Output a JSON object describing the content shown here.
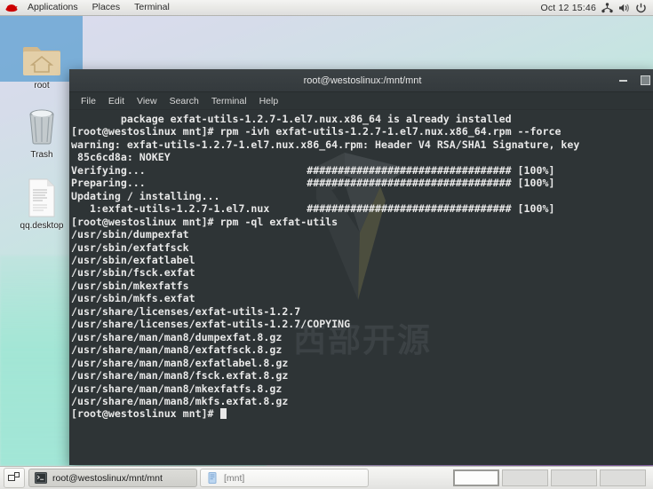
{
  "top_panel": {
    "logo_icon": "redhat-logo-icon",
    "menus": [
      {
        "label": "Applications",
        "name": "menu-applications"
      },
      {
        "label": "Places",
        "name": "menu-places"
      },
      {
        "label": "Terminal",
        "name": "menu-terminal"
      }
    ],
    "clock": "Oct 12  15:46",
    "tray": [
      {
        "icon": "network-icon"
      },
      {
        "icon": "volume-icon"
      },
      {
        "icon": "power-icon"
      }
    ]
  },
  "desktop": {
    "icons": [
      {
        "label": "root",
        "icon": "home-folder-icon",
        "selected": true
      },
      {
        "label": "Trash",
        "icon": "trash-icon",
        "selected": false
      },
      {
        "label": "qq.desktop",
        "icon": "text-file-icon",
        "selected": false
      }
    ]
  },
  "terminal": {
    "title": "root@westoslinux:/mnt/mnt",
    "menus": [
      "File",
      "Edit",
      "View",
      "Search",
      "Terminal",
      "Help"
    ],
    "controls": {
      "minimize": "minimize-icon",
      "maximize": "maximize-icon"
    },
    "watermark_text": "西部开源",
    "content": "        package exfat-utils-1.2.7-1.el7.nux.x86_64 is already installed\n[root@westoslinux mnt]# rpm -ivh exfat-utils-1.2.7-1.el7.nux.x86_64.rpm --force\nwarning: exfat-utils-1.2.7-1.el7.nux.x86_64.rpm: Header V4 RSA/SHA1 Signature, key\n 85c6cd8a: NOKEY\nVerifying...                          ################################# [100%]\nPreparing...                          ################################# [100%]\nUpdating / installing...\n   1:exfat-utils-1.2.7-1.el7.nux      ################################# [100%]\n[root@westoslinux mnt]# rpm -ql exfat-utils\n/usr/sbin/dumpexfat\n/usr/sbin/exfatfsck\n/usr/sbin/exfatlabel\n/usr/sbin/fsck.exfat\n/usr/sbin/mkexfatfs\n/usr/sbin/mkfs.exfat\n/usr/share/licenses/exfat-utils-1.2.7\n/usr/share/licenses/exfat-utils-1.2.7/COPYING\n/usr/share/man/man8/dumpexfat.8.gz\n/usr/share/man/man8/exfatfsck.8.gz\n/usr/share/man/man8/exfatlabel.8.gz\n/usr/share/man/man8/fsck.exfat.8.gz\n/usr/share/man/man8/mkexfatfs.8.gz\n/usr/share/man/man8/mkfs.exfat.8.gz\n[root@westoslinux mnt]# ",
    "colors": {
      "background": "#2e3436",
      "foreground": "#e8e8e8",
      "titlebar": "#343a3d"
    }
  },
  "bottom_panel": {
    "show_desktop_icon": "show-desktop-icon",
    "tasks": [
      {
        "label": "root@westoslinux/mnt/mnt",
        "icon": "terminal-icon",
        "active": true
      },
      {
        "label": "[mnt]",
        "icon": "file-manager-icon",
        "active": false
      }
    ],
    "workspaces": [
      {
        "active": true
      },
      {
        "active": false
      },
      {
        "active": false
      },
      {
        "active": false
      }
    ]
  }
}
